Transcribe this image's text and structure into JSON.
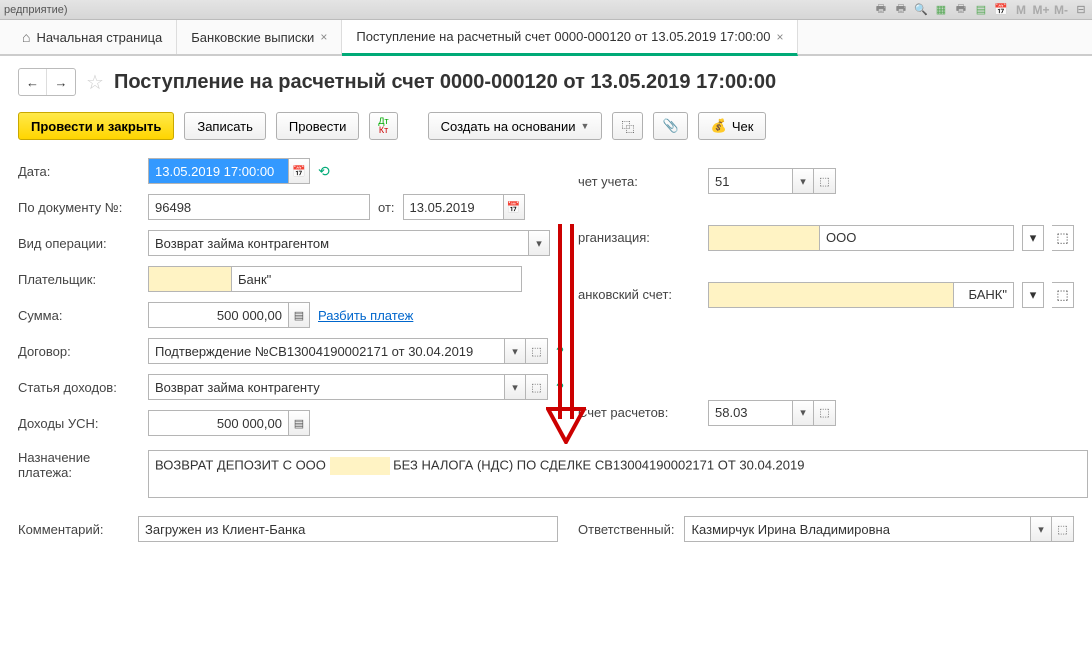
{
  "window": {
    "title_fragment": "редприятие)"
  },
  "tabs": {
    "home": "Начальная страница",
    "t1": "Банковские выписки",
    "t2": "Поступление на расчетный счет 0000-000120 от 13.05.2019 17:00:00"
  },
  "header": {
    "title": "Поступление на расчетный счет 0000-000120 от 13.05.2019 17:00:00"
  },
  "toolbar": {
    "post_close": "Провести и закрыть",
    "save": "Записать",
    "post": "Провести",
    "create_based": "Создать на основании",
    "cheque": "Чек"
  },
  "form": {
    "date_label": "Дата:",
    "date_value": "13.05.2019 17:00:00",
    "doc_num_label": "По документу №:",
    "doc_num_value": "96498",
    "ot_label": "от:",
    "ot_value": "13.05.2019",
    "op_type_label": "Вид операции:",
    "op_type_value": "Возврат займа контрагентом",
    "payer_label": "Плательщик:",
    "payer_value": "Банк\"",
    "sum_label": "Сумма:",
    "sum_value": "500 000,00",
    "split_link": "Разбить платеж",
    "contract_label": "Договор:",
    "contract_value": "Подтверждение №СВ13004190002171 от 30.04.2019",
    "income_label": "Статья доходов:",
    "income_value": "Возврат займа контрагенту",
    "usn_label": "Доходы УСН:",
    "usn_value": "500 000,00",
    "purpose_label": "Назначение платежа:",
    "purpose_value": "ВОЗВРАТ ДЕПОЗИТ С ООО                     БЕЗ НАЛОГА (НДС) ПО СДЕЛКЕ СВ13004190002171 ОТ 30.04.2019",
    "comment_label": "Комментарий:",
    "comment_value": "Загружен из Клиент-Банка"
  },
  "right": {
    "account_label": "чет учета:",
    "account_value": "51",
    "org_label": "рганизация:",
    "org_value": "ООО",
    "bank_label": "анковский счет:",
    "bank_value": "БАНК\"",
    "calc_label": "Счет расчетов:",
    "calc_value": "58.03",
    "resp_label": "Ответственный:",
    "resp_value": "Казмирчук Ирина Владимировна"
  }
}
